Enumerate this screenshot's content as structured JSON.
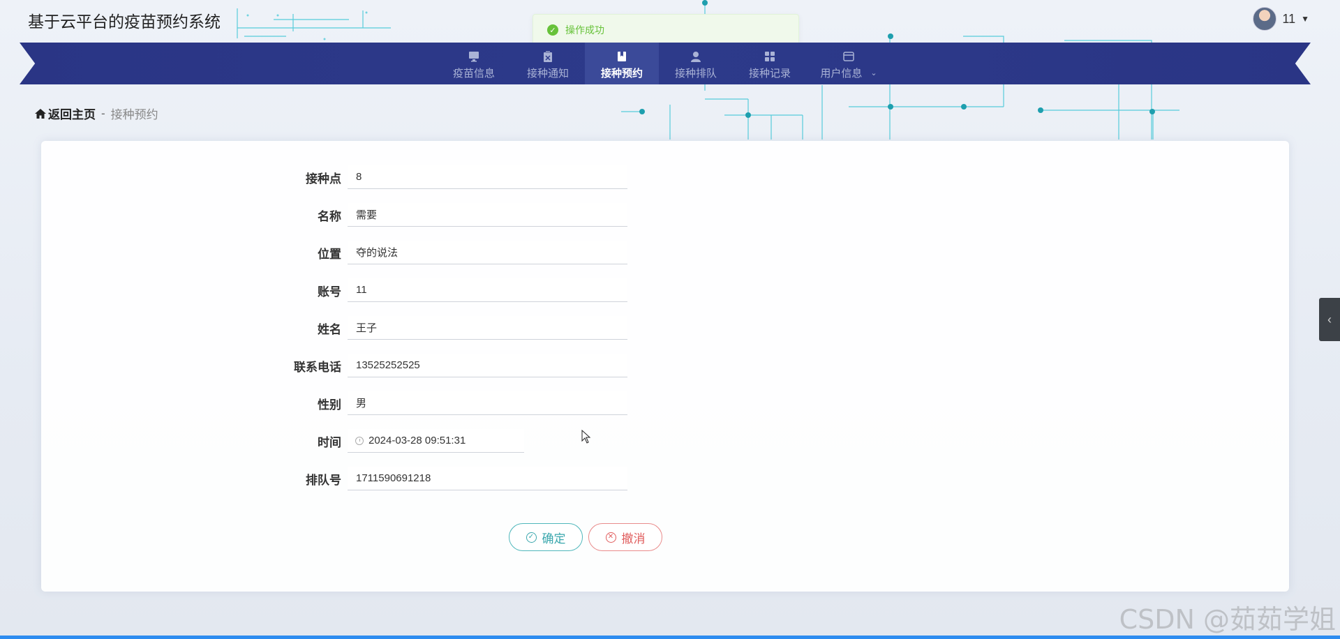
{
  "app": {
    "title": "基于云平台的疫苗预约系统"
  },
  "user": {
    "name": "11"
  },
  "toast": {
    "message": "操作成功"
  },
  "nav": {
    "items": [
      {
        "label": "疫苗信息",
        "icon": "monitor-icon"
      },
      {
        "label": "接种通知",
        "icon": "clipboard-icon"
      },
      {
        "label": "接种预约",
        "icon": "book-icon",
        "active": true
      },
      {
        "label": "接种排队",
        "icon": "person-icon"
      },
      {
        "label": "接种记录",
        "icon": "grid-icon"
      },
      {
        "label": "用户信息",
        "icon": "card-icon"
      }
    ]
  },
  "breadcrumb": {
    "home": "返回主页",
    "separator": "-",
    "current": "接种预约"
  },
  "form": {
    "fields": [
      {
        "label": "接种点",
        "value": "8"
      },
      {
        "label": "名称",
        "value": "需要"
      },
      {
        "label": "位置",
        "value": "夺的说法"
      },
      {
        "label": "账号",
        "value": "11"
      },
      {
        "label": "姓名",
        "value": "王子"
      },
      {
        "label": "联系电话",
        "value": "13525252525"
      },
      {
        "label": "性别",
        "value": "男"
      },
      {
        "label": "时间",
        "value": "2024-03-28 09:51:31"
      },
      {
        "label": "排队号",
        "value": "1711590691218"
      }
    ],
    "confirm_label": "确定",
    "cancel_label": "撤消"
  },
  "watermark": "CSDN @茹茹学姐",
  "colors": {
    "nav_bg": "#2d3a8a",
    "nav_active": "#3b4a99",
    "success": "#67c23a",
    "confirm": "#3aa7ad",
    "cancel": "#e05c5c"
  }
}
